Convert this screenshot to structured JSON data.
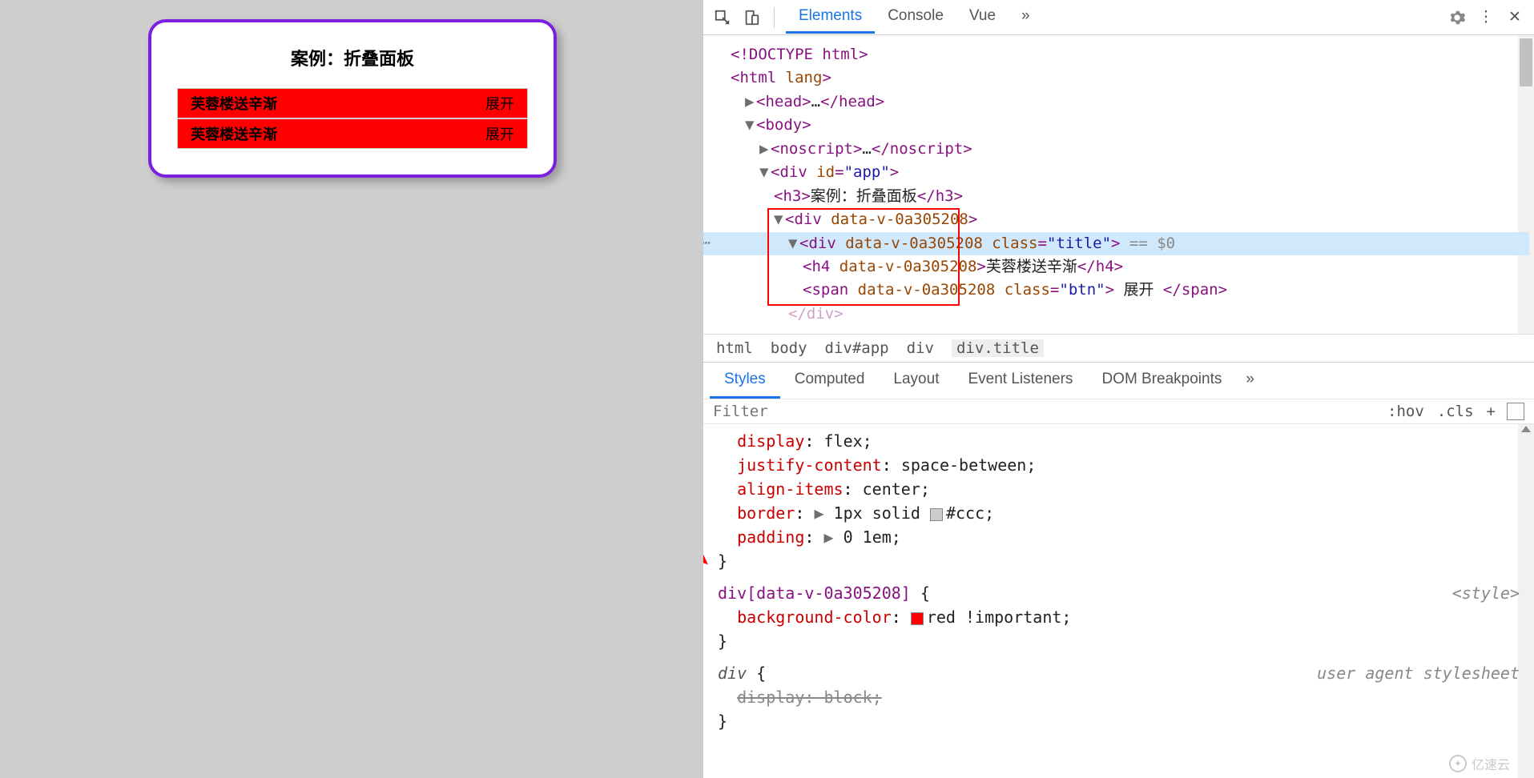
{
  "app": {
    "title": "案例：折叠面板",
    "panels": [
      {
        "title": "芙蓉楼送辛渐",
        "btn": "展开"
      },
      {
        "title": "芙蓉楼送辛渐",
        "btn": "展开"
      }
    ]
  },
  "devtools": {
    "tabs": {
      "elements": "Elements",
      "console": "Console",
      "vue": "Vue",
      "more": "»"
    },
    "dom": {
      "doctype": "<!DOCTYPE html>",
      "html_open": "html",
      "lang_attr": "lang",
      "head": "head",
      "ellipsis": "…",
      "body": "body",
      "noscript": "noscript",
      "div": "div",
      "id_attr": "id",
      "app_val": "\"app\"",
      "h3": "h3",
      "h3_text": "案例：折叠面板",
      "datav": "data-v-0a305208",
      "class_attr": "class",
      "title_val": "\"title\"",
      "h4": "h4",
      "h4_text": "芙蓉楼送辛渐",
      "span": "span",
      "btn_val": "\"btn\"",
      "btn_text": " 展开 ",
      "end_div": "</div>",
      "sel_suffix": " == $0"
    },
    "breadcrumb": [
      "html",
      "body",
      "div#app",
      "div",
      "div.title"
    ],
    "styles_tabs": {
      "styles": "Styles",
      "computed": "Computed",
      "layout": "Layout",
      "event": "Event Listeners",
      "dom_bp": "DOM Breakpoints",
      "more": "»"
    },
    "filter": {
      "placeholder": "Filter",
      "hov": ":hov",
      "cls": ".cls",
      "plus": "+"
    },
    "rules": {
      "r1": {
        "display": "display",
        "display_v": "flex;",
        "jc": "justify-content",
        "jc_v": "space-between;",
        "ai": "align-items",
        "ai_v": "center;",
        "border": "border",
        "border_v": "1px solid ",
        "border_hex": "#ccc;",
        "padding": "padding",
        "padding_v": "0 1em;"
      },
      "r2": {
        "selector": "div[data-v-0a305208]",
        "bg": "background-color",
        "bg_v": "red !important;",
        "origin": "<style>"
      },
      "r3": {
        "selector": "div",
        "display": "display",
        "display_v": "block;",
        "origin": "user agent stylesheet"
      }
    }
  },
  "watermark": "亿速云"
}
